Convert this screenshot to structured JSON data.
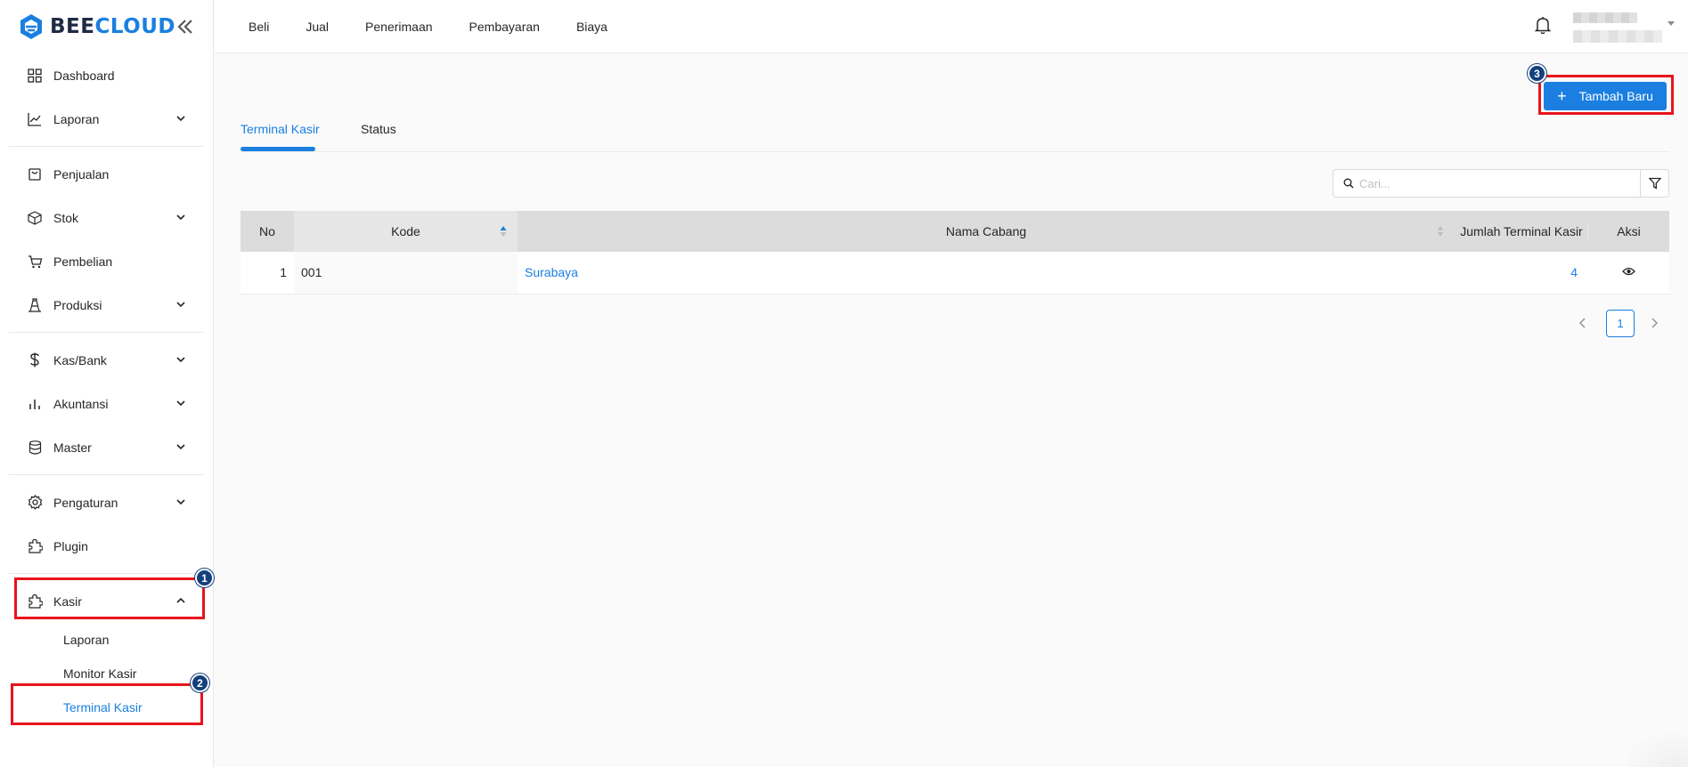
{
  "app": {
    "logo_part1": "BEE",
    "logo_part2": "CLOUD",
    "brand_color": "#1a7fe0"
  },
  "sidebar": {
    "items": [
      {
        "label": "Dashboard",
        "icon": "dashboard-icon"
      },
      {
        "label": "Laporan",
        "icon": "chart-line-icon"
      },
      {
        "label": "Penjualan",
        "icon": "bag-icon"
      },
      {
        "label": "Stok",
        "icon": "box-icon"
      },
      {
        "label": "Pembelian",
        "icon": "cart-icon"
      },
      {
        "label": "Produksi",
        "icon": "production-icon"
      },
      {
        "label": "Kas/Bank",
        "icon": "dollar-icon"
      },
      {
        "label": "Akuntansi",
        "icon": "bar-chart-icon"
      },
      {
        "label": "Master",
        "icon": "database-icon"
      },
      {
        "label": "Pengaturan",
        "icon": "gear-icon"
      },
      {
        "label": "Plugin",
        "icon": "puzzle-icon"
      },
      {
        "label": "Kasir",
        "icon": "puzzle-icon"
      }
    ],
    "kasir_submenu": [
      {
        "label": "Laporan"
      },
      {
        "label": "Monitor Kasir"
      },
      {
        "label": "Terminal Kasir"
      }
    ]
  },
  "topnav": {
    "items": [
      "Beli",
      "Jual",
      "Penerimaan",
      "Pembayaran",
      "Biaya"
    ]
  },
  "main": {
    "add_button_label": "Tambah Baru",
    "tabs": [
      {
        "label": "Terminal Kasir"
      },
      {
        "label": "Status"
      }
    ],
    "search_placeholder": "Cari...",
    "table": {
      "headers": [
        "No",
        "Kode",
        "Nama Cabang",
        "Jumlah Terminal Kasir",
        "Aksi"
      ],
      "rows": [
        {
          "no": "1",
          "kode": "001",
          "nama_cabang": "Surabaya",
          "jumlah": "4"
        }
      ]
    },
    "pager": {
      "current_page": "1"
    }
  },
  "annotations": {
    "markers": [
      "1",
      "2",
      "3"
    ],
    "highlight_color": "#e8141c"
  }
}
